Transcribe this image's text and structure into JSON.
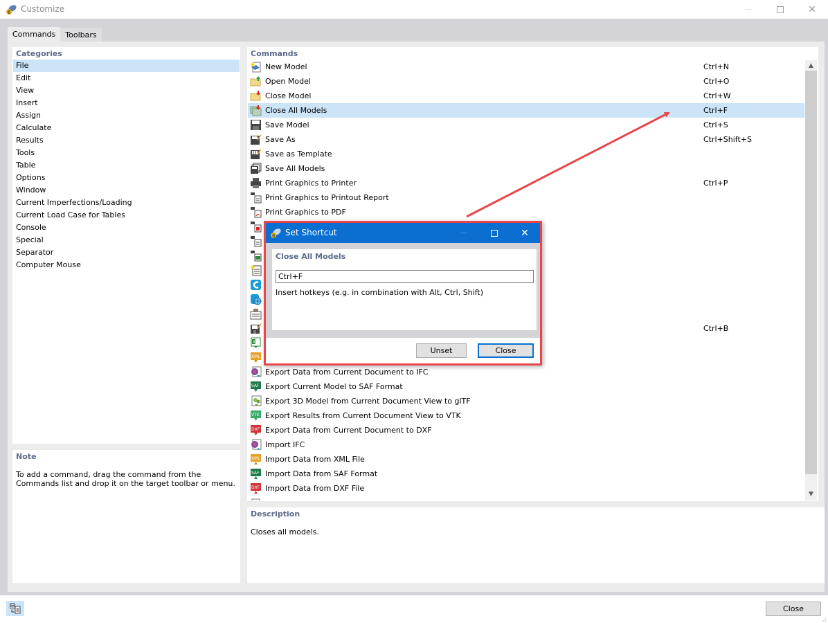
{
  "window": {
    "title": "Customize",
    "icon": "rfem-app-icon",
    "controls": [
      "minimize",
      "maximize",
      "close"
    ]
  },
  "tabs": [
    {
      "label": "Commands",
      "active": true
    },
    {
      "label": "Toolbars",
      "active": false
    }
  ],
  "categories": {
    "header": "Categories",
    "selected": "File",
    "items": [
      "File",
      "Edit",
      "View",
      "Insert",
      "Assign",
      "Calculate",
      "Results",
      "Tools",
      "Table",
      "Options",
      "Window",
      "Current Imperfections/Loading",
      "Current Load Case for Tables",
      "Console",
      "Special",
      "Separator",
      "Computer Mouse"
    ]
  },
  "note": {
    "header": "Note",
    "text": "To add a command, drag the command from the Commands list and drop it on the target toolbar or menu."
  },
  "commands": {
    "header": "Commands",
    "selected": "Close All Models",
    "items": [
      {
        "label": "New Model",
        "shortcut": "Ctrl+N",
        "icon": "new-model-icon"
      },
      {
        "label": "Open Model",
        "shortcut": "Ctrl+O",
        "icon": "open-folder-icon"
      },
      {
        "label": "Close Model",
        "shortcut": "Ctrl+W",
        "icon": "close-folder-icon"
      },
      {
        "label": "Close All Models",
        "shortcut": "Ctrl+F",
        "icon": "close-all-models-icon"
      },
      {
        "label": "Save Model",
        "shortcut": "Ctrl+S",
        "icon": "save-icon"
      },
      {
        "label": "Save As",
        "shortcut": "Ctrl+Shift+S",
        "icon": "save-as-icon"
      },
      {
        "label": "Save as Template",
        "shortcut": "",
        "icon": "save-template-icon"
      },
      {
        "label": "Save All Models",
        "shortcut": "",
        "icon": "save-all-icon"
      },
      {
        "label": "Print Graphics to Printer",
        "shortcut": "Ctrl+P",
        "icon": "printer-icon"
      },
      {
        "label": "Print Graphics to Printout Report",
        "shortcut": "",
        "icon": "print-report-icon"
      },
      {
        "label": "Print Graphics to PDF",
        "shortcut": "",
        "icon": "print-pdf-icon"
      },
      {
        "label": "",
        "shortcut": "",
        "icon": "print-pdf-red-icon"
      },
      {
        "label": "",
        "shortcut": "",
        "icon": "print-document-icon"
      },
      {
        "label": "",
        "shortcut": "",
        "icon": "print-excel-icon"
      },
      {
        "label": "",
        "shortcut": "",
        "icon": "new-report-icon"
      },
      {
        "label": "",
        "shortcut": "",
        "icon": "cloud-c-icon"
      },
      {
        "label": "",
        "shortcut": "",
        "icon": "web-service-icon"
      },
      {
        "label": "",
        "shortcut": "",
        "icon": "project-manager-icon"
      },
      {
        "label": "",
        "shortcut": "Ctrl+B",
        "icon": "save-block-icon"
      },
      {
        "label": "",
        "shortcut": "",
        "icon": "excel-export-icon"
      },
      {
        "label": "",
        "shortcut": "",
        "icon": "xml-export-icon"
      },
      {
        "label": "Export Data from Current Document to IFC",
        "shortcut": "",
        "icon": "ifc-export-icon"
      },
      {
        "label": "Export Current Model to SAF Format",
        "shortcut": "",
        "icon": "saf-export-icon"
      },
      {
        "label": "Export 3D Model from Current Document View to glTF",
        "shortcut": "",
        "icon": "gltf-export-icon"
      },
      {
        "label": "Export Results from Current Document View to VTK",
        "shortcut": "",
        "icon": "vtk-export-icon"
      },
      {
        "label": "Export Data from Current Document to DXF",
        "shortcut": "",
        "icon": "dxf-export-icon"
      },
      {
        "label": "Import IFC",
        "shortcut": "",
        "icon": "ifc-import-icon"
      },
      {
        "label": "Import Data from XML File",
        "shortcut": "",
        "icon": "xml-import-icon"
      },
      {
        "label": "Import Data from SAF Format",
        "shortcut": "",
        "icon": "saf-import-icon"
      },
      {
        "label": "Import Data from DXF File",
        "shortcut": "",
        "icon": "dxf-import-icon"
      }
    ]
  },
  "description": {
    "header": "Description",
    "text": "Closes all models."
  },
  "footer": {
    "close_label": "Close",
    "icon": "database-report-icon"
  },
  "dialog": {
    "title": "Set Shortcut",
    "command_name": "Close All Models",
    "shortcut_value": "Ctrl+F",
    "hint": "Insert hotkeys (e.g. in combination with Alt, Ctrl, Shift)",
    "unset_label": "Unset",
    "close_label": "Close"
  },
  "annotation": {
    "color": "#e8464a",
    "type": "arrow",
    "from": "Set Shortcut dialog",
    "to": "Ctrl+F shortcut of Close All Models"
  },
  "colors": {
    "selection": "#cce4f7",
    "header_text": "#5b6a8a",
    "dialog_titlebar": "#0a6fd0",
    "highlight_border": "#e8464a"
  }
}
